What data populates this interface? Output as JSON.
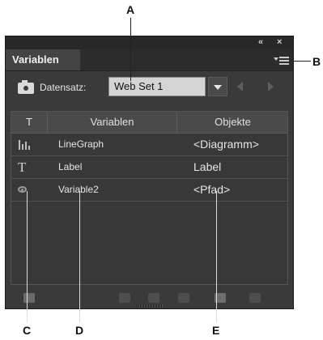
{
  "callouts": {
    "a": "A",
    "b": "B",
    "c": "C",
    "d": "D",
    "e": "E"
  },
  "panel": {
    "window_controls": {
      "collapse": "«",
      "close": "×"
    },
    "tab_label": "Variablen",
    "menu_icon": "panel-menu-icon",
    "dataset": {
      "label": "Datensatz:",
      "value": "Web Set 1"
    },
    "table": {
      "headers": [
        "T",
        "Variablen",
        "Objekte"
      ],
      "rows": [
        {
          "icon": "graph-icon",
          "name": "LineGraph",
          "object": "<Diagramm>"
        },
        {
          "icon": "text-icon",
          "name": "Label",
          "object": "Label"
        },
        {
          "icon": "visibility-eye-icon",
          "name": "Variable2",
          "object": "<Pfad>"
        }
      ]
    },
    "bottom_icons": [
      "load-library-icon",
      "make-dynamic-icon",
      "make-visible-icon",
      "unbind-icon",
      "new-variable-icon",
      "delete-icon"
    ]
  }
}
